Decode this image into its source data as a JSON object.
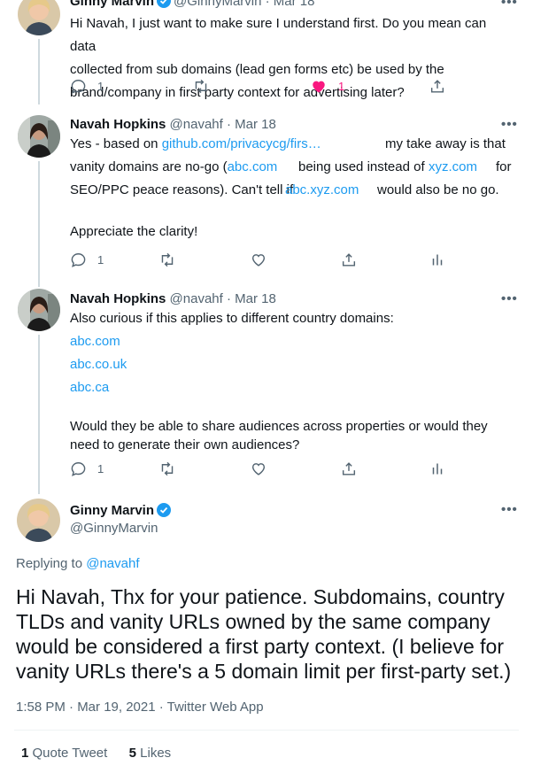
{
  "tweets": [
    {
      "name": "Ginny Marvin",
      "handle": "@GinnyMarvin",
      "date": "Mar 18",
      "lines": [
        "Hi Navah, I just want to make sure I understand first. Do you mean can data",
        "collected from sub domains (lead gen forms etc) be used by the",
        "brand/company in first party context for advertising later?"
      ],
      "actions": {
        "reply": "1",
        "retweet": "",
        "like": "1"
      }
    },
    {
      "name": "Navah Hopkins",
      "handle": "@navahf",
      "date": "Mar 18",
      "text": {
        "l1a": "Yes - based on ",
        "l1link": "github.com/privacycg/firs…",
        "l1b": "my take away is that",
        "l2a": "vanity domains are no-go (",
        "l2link1": "abc.com",
        "l2b": "being used instead of",
        "l2link2": "xyz.com",
        "l2c": "for",
        "l3a": "SEO/PPC peace reasons). Can't tell if",
        "l3link": "abc.xyz.com",
        "l3b": "would also be no go.",
        "l4": "Appreciate the clarity!"
      },
      "actions": {
        "reply": "1"
      }
    },
    {
      "name": "Navah Hopkins",
      "handle": "@navahf",
      "date": "Mar 18",
      "intro": "Also curious if this applies to different country domains:",
      "links": [
        "abc.com",
        "abc.co.uk",
        "abc.ca"
      ],
      "q1": "Would they be able to share audiences across properties or would they",
      "q2": "need to generate their own audiences?",
      "actions": {
        "reply": "1"
      }
    }
  ],
  "main": {
    "name": "Ginny Marvin",
    "handle": "@GinnyMarvin",
    "replying_prefix": "Replying to",
    "replying_to": "@navahf",
    "lines": [
      "Hi Navah, Thx for your patience. Subdomains, country",
      "TLDs and vanity URLs owned by the same company",
      "would be considered a first party context. (I believe for",
      "vanity URLs there's a 5 domain limit per first-party set.)"
    ],
    "timestamp": "1:58 PM · Mar 19, 2021 · Twitter Web App",
    "quote_count": "1",
    "quote_label": "Quote Tweet",
    "likes_count": "5",
    "likes_label": "Likes"
  },
  "colors": {
    "accent": "#1d9bf0",
    "like": "#f91880",
    "muted": "#536471"
  }
}
